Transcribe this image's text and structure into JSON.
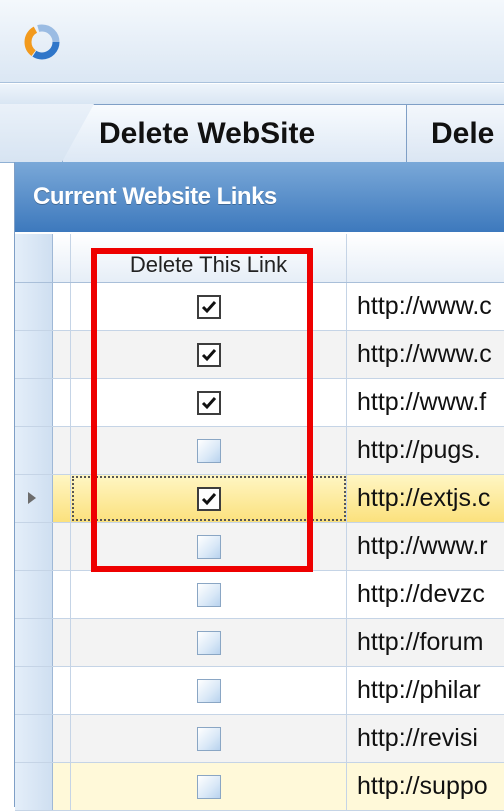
{
  "tabs": [
    {
      "label": "Delete WebSite"
    },
    {
      "label": "Dele"
    }
  ],
  "panel": {
    "title": "Current Website Links"
  },
  "grid": {
    "columns": {
      "delete": "Delete This Link",
      "url": ""
    },
    "rows": [
      {
        "checked": true,
        "url": "http://www.c"
      },
      {
        "checked": true,
        "url": "http://www.c"
      },
      {
        "checked": true,
        "url": "http://www.f"
      },
      {
        "checked": false,
        "url": "http://pugs."
      },
      {
        "checked": true,
        "url": "http://extjs.c",
        "current": true
      },
      {
        "checked": false,
        "url": "http://www.r"
      },
      {
        "checked": false,
        "url": "http://devzc"
      },
      {
        "checked": false,
        "url": "http://forum"
      },
      {
        "checked": false,
        "url": "http://philar"
      },
      {
        "checked": false,
        "url": "http://revisi"
      },
      {
        "checked": false,
        "url": "http://suppo"
      }
    ]
  },
  "colors": {
    "highlight_box": "#ee0000",
    "panel_header": "#3d79bd",
    "current_row": "#fbe17d"
  }
}
